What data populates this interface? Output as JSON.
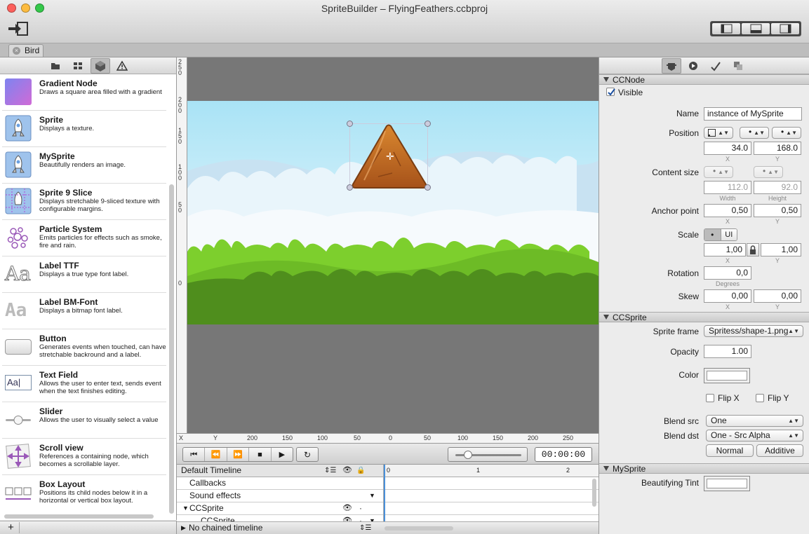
{
  "window": {
    "title": "SpriteBuilder – FlyingFeathers.ccbproj"
  },
  "tabs": [
    {
      "label": "Bird"
    }
  ],
  "library": {
    "items": [
      {
        "title": "Gradient Node",
        "desc": "Draws a square area filled with a gradient",
        "icon": "gradient-icon"
      },
      {
        "title": "Sprite",
        "desc": "Displays a texture.",
        "icon": "sprite-icon"
      },
      {
        "title": "MySprite",
        "desc": "Beautifully renders an image.",
        "icon": "sprite-icon"
      },
      {
        "title": "Sprite 9 Slice",
        "desc": "Displays stretchable 9-sliced texture with configurable margins.",
        "icon": "sprite-9-slice-icon"
      },
      {
        "title": "Particle System",
        "desc": "Emits particles for effects such as smoke, fire and rain.",
        "icon": "particle-icon"
      },
      {
        "title": "Label TTF",
        "desc": "Displays a true type font label.",
        "icon": "label-ttf-icon"
      },
      {
        "title": "Label BM-Font",
        "desc": "Displays a bitmap font label.",
        "icon": "label-bmfont-icon"
      },
      {
        "title": "Button",
        "desc": "Generates events when touched, can have stretchable backround and a label.",
        "icon": "button-icon"
      },
      {
        "title": "Text Field",
        "desc": "Allows the user to enter text, sends event when the text finishes editing.",
        "icon": "text-field-icon"
      },
      {
        "title": "Slider",
        "desc": "Allows the user to visually select a value",
        "icon": "slider-icon"
      },
      {
        "title": "Scroll view",
        "desc": "References a containing node, which becomes a scrollable layer.",
        "icon": "scroll-view-icon"
      },
      {
        "title": "Box Layout",
        "desc": "Positions its child nodes below it in a horizontal or vertical box layout.",
        "icon": "box-layout-icon"
      }
    ],
    "icon_text": {
      "ttf": "Aa",
      "bm": "Aa",
      "textfield": "Aa|"
    },
    "add_label": "+"
  },
  "ruler": {
    "vertical": [
      "250",
      "200",
      "150",
      "100",
      "50",
      "0"
    ],
    "horizontal": [
      "X",
      "Y",
      "200",
      "150",
      "100",
      "50",
      "0",
      "50",
      "100",
      "150",
      "200",
      "250"
    ]
  },
  "timeline": {
    "timecode": "00:00:00",
    "header": "Default Timeline",
    "rows": [
      "Callbacks",
      "Sound effects",
      "CCSprite",
      "CCSprite"
    ],
    "ticks": [
      "0",
      "1",
      "2"
    ],
    "chained": "No chained timeline",
    "controls": {
      "first": "⏮",
      "prev": "⏪",
      "next": "⏩",
      "stop": "■",
      "play": "▶",
      "loop": "↻"
    }
  },
  "inspector": {
    "ccnode": {
      "header": "CCNode",
      "visible_label": "Visible",
      "name_label": "Name",
      "name_value": "instance of MySprite",
      "position_label": "Position",
      "position_x": "34.0",
      "position_y": "168.0",
      "content_size_label": "Content size",
      "content_w": "112.0",
      "content_h": "92.0",
      "anchor_label": "Anchor point",
      "anchor_x": "0,50",
      "anchor_y": "0,50",
      "scale_label": "Scale",
      "scale_ui": "UI",
      "scale_x": "1,00",
      "scale_y": "1,00",
      "rotation_label": "Rotation",
      "rotation_value": "0,0",
      "skew_label": "Skew",
      "skew_x": "0,00",
      "skew_y": "0,00",
      "sub_x": "X",
      "sub_y": "Y",
      "sub_width": "Width",
      "sub_height": "Height",
      "sub_degrees": "Degrees"
    },
    "ccsprite": {
      "header": "CCSprite",
      "frame_label": "Sprite frame",
      "frame_value": "Spritess/shape-1.png",
      "opacity_label": "Opacity",
      "opacity_value": "1.00",
      "color_label": "Color",
      "flipx_label": "Flip X",
      "flipy_label": "Flip Y",
      "blend_src_label": "Blend src",
      "blend_src_value": "One",
      "blend_dst_label": "Blend dst",
      "blend_dst_value": "One - Src Alpha",
      "normal_label": "Normal",
      "additive_label": "Additive"
    },
    "mysprite": {
      "header": "MySprite",
      "tint_label": "Beautifying Tint"
    }
  },
  "colors": {
    "sky_top": "#a9e3f5",
    "grass": "#5fa61e",
    "sprite": "#c4691f"
  }
}
